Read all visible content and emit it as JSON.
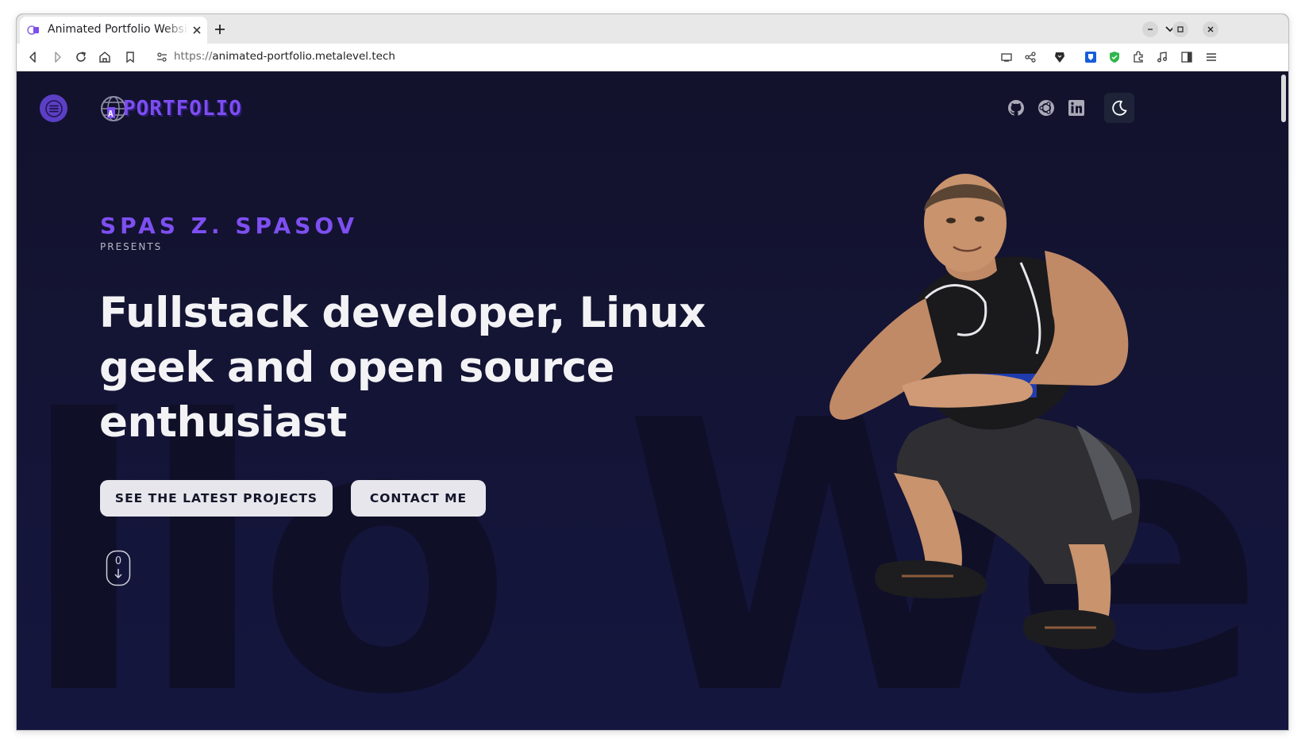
{
  "browser": {
    "tab_title": "Animated Portfolio Website",
    "url_scheme": "https://",
    "url_host": "animated-portfolio.metalevel.tech"
  },
  "header": {
    "logo_text": "PORTFOLIO",
    "brand_color": "#7e4ff2",
    "social_icons": [
      "github-icon",
      "ubuntu-icon",
      "linkedin-icon"
    ],
    "theme_toggle_icon": "moon-icon"
  },
  "hero": {
    "name": "SPAS Z. SPASOV",
    "presents": "PRESENTS",
    "headline": "Fullstack developer, Linux geek and open source enthusiast",
    "buttons": {
      "projects": "SEE THE LATEST PROJECTS",
      "contact": "CONTACT ME"
    },
    "background_text": "llo We",
    "scroll_indicator_digit": "0"
  },
  "colors": {
    "page_background": "#14142e",
    "accent": "#7e4ff2",
    "button_background": "#e6e6ec"
  }
}
